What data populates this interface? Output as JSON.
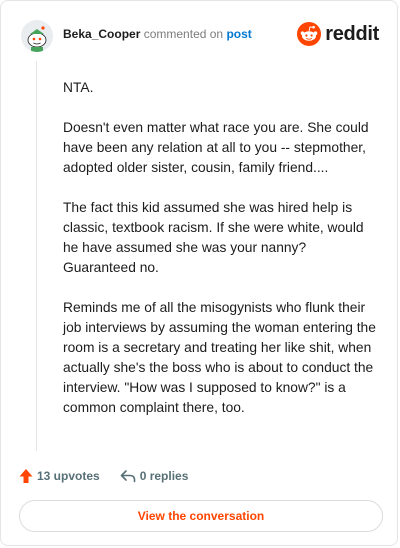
{
  "header": {
    "author": "Beka_Cooper",
    "verb": "commented on",
    "link_text": "post",
    "brand": "reddit"
  },
  "comment": {
    "paragraphs": [
      "NTA.",
      "Doesn't even matter what race you are. She could have been any relation at all to you -- stepmother, adopted older sister, cousin, family friend....",
      "The fact this kid assumed she was hired help is classic, textbook racism. If she were white, would he have assumed she was your nanny? Guaranteed no.",
      "Reminds me of all the misogynists who flunk their job interviews by assuming the woman entering the room is a secretary and treating her like shit, when actually she's the boss who is about to conduct the interview. \"How was I supposed to know?\" is a common complaint there, too."
    ]
  },
  "actions": {
    "upvotes": "13 upvotes",
    "replies": "0 replies"
  },
  "footer": {
    "view_label": "View the conversation"
  },
  "colors": {
    "accent": "#ff4500",
    "link": "#0079d3"
  },
  "icons": [
    "snoo-avatar-icon",
    "reddit-logo-icon",
    "upvote-arrow-icon",
    "reply-arrow-icon"
  ]
}
